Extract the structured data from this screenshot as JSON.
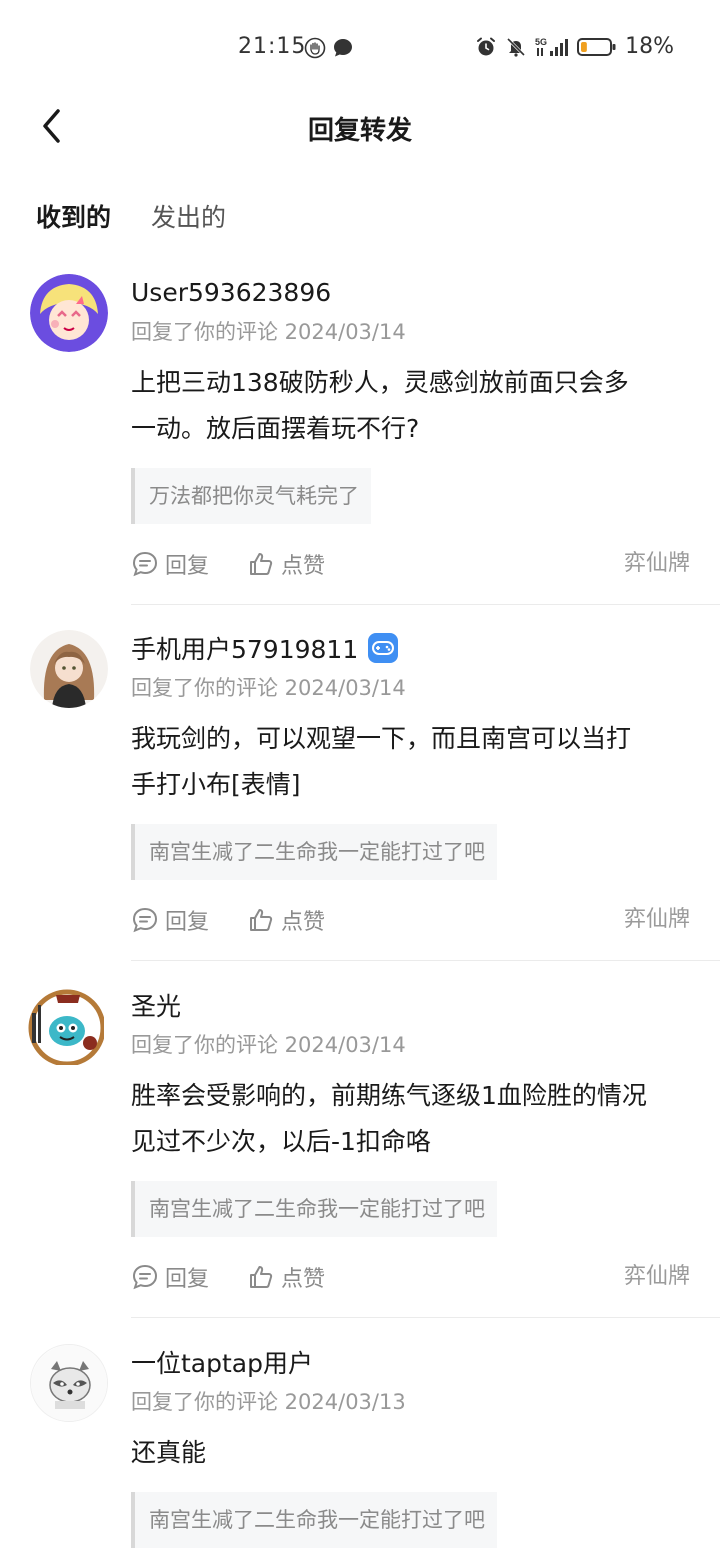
{
  "status_bar": {
    "time": "21:15",
    "battery_percent": "18%",
    "battery_level": 0.18,
    "network": "5G"
  },
  "header": {
    "title": "回复转发"
  },
  "tabs": [
    {
      "label": "收到的",
      "active": true
    },
    {
      "label": "发出的",
      "active": false
    }
  ],
  "actions": {
    "reply_label": "回复",
    "like_label": "点赞"
  },
  "items": [
    {
      "username": "User593623896",
      "meta": "回复了你的评论 2024/03/14",
      "body_lines": [
        "上把三动138破防秒人，灵感剑放前面只会多",
        "一动。放后面摆着玩不行?"
      ],
      "quote": "万法都把你灵气耗完了",
      "tag": "弈仙牌",
      "avatar_color": "#6b4de0"
    },
    {
      "username": "手机用户57919811",
      "meta": "回复了你的评论 2024/03/14",
      "body_lines": [
        "我玩剑的，可以观望一下，而且南宫可以当打",
        "手打小布[表情]"
      ],
      "quote": "南宫生减了二生命我一定能打过了吧",
      "tag": "弈仙牌",
      "avatar_color": "#c9a88a"
    },
    {
      "username": "圣光",
      "meta": "回复了你的评论 2024/03/14",
      "body_lines": [
        "胜率会受影响的，前期练气逐级1血险胜的情况",
        "见过不少次，以后-1扣命咯"
      ],
      "quote": "南宫生减了二生命我一定能打过了吧",
      "tag": "弈仙牌",
      "avatar_color": "#3cb8c8"
    },
    {
      "username": "一位taptap用户",
      "meta": "回复了你的评论 2024/03/13",
      "body_lines": [
        "还真能"
      ],
      "quote": "南宫生减了二生命我一定能打过了吧",
      "tag": "",
      "avatar_color": "#f2f2f2"
    }
  ]
}
